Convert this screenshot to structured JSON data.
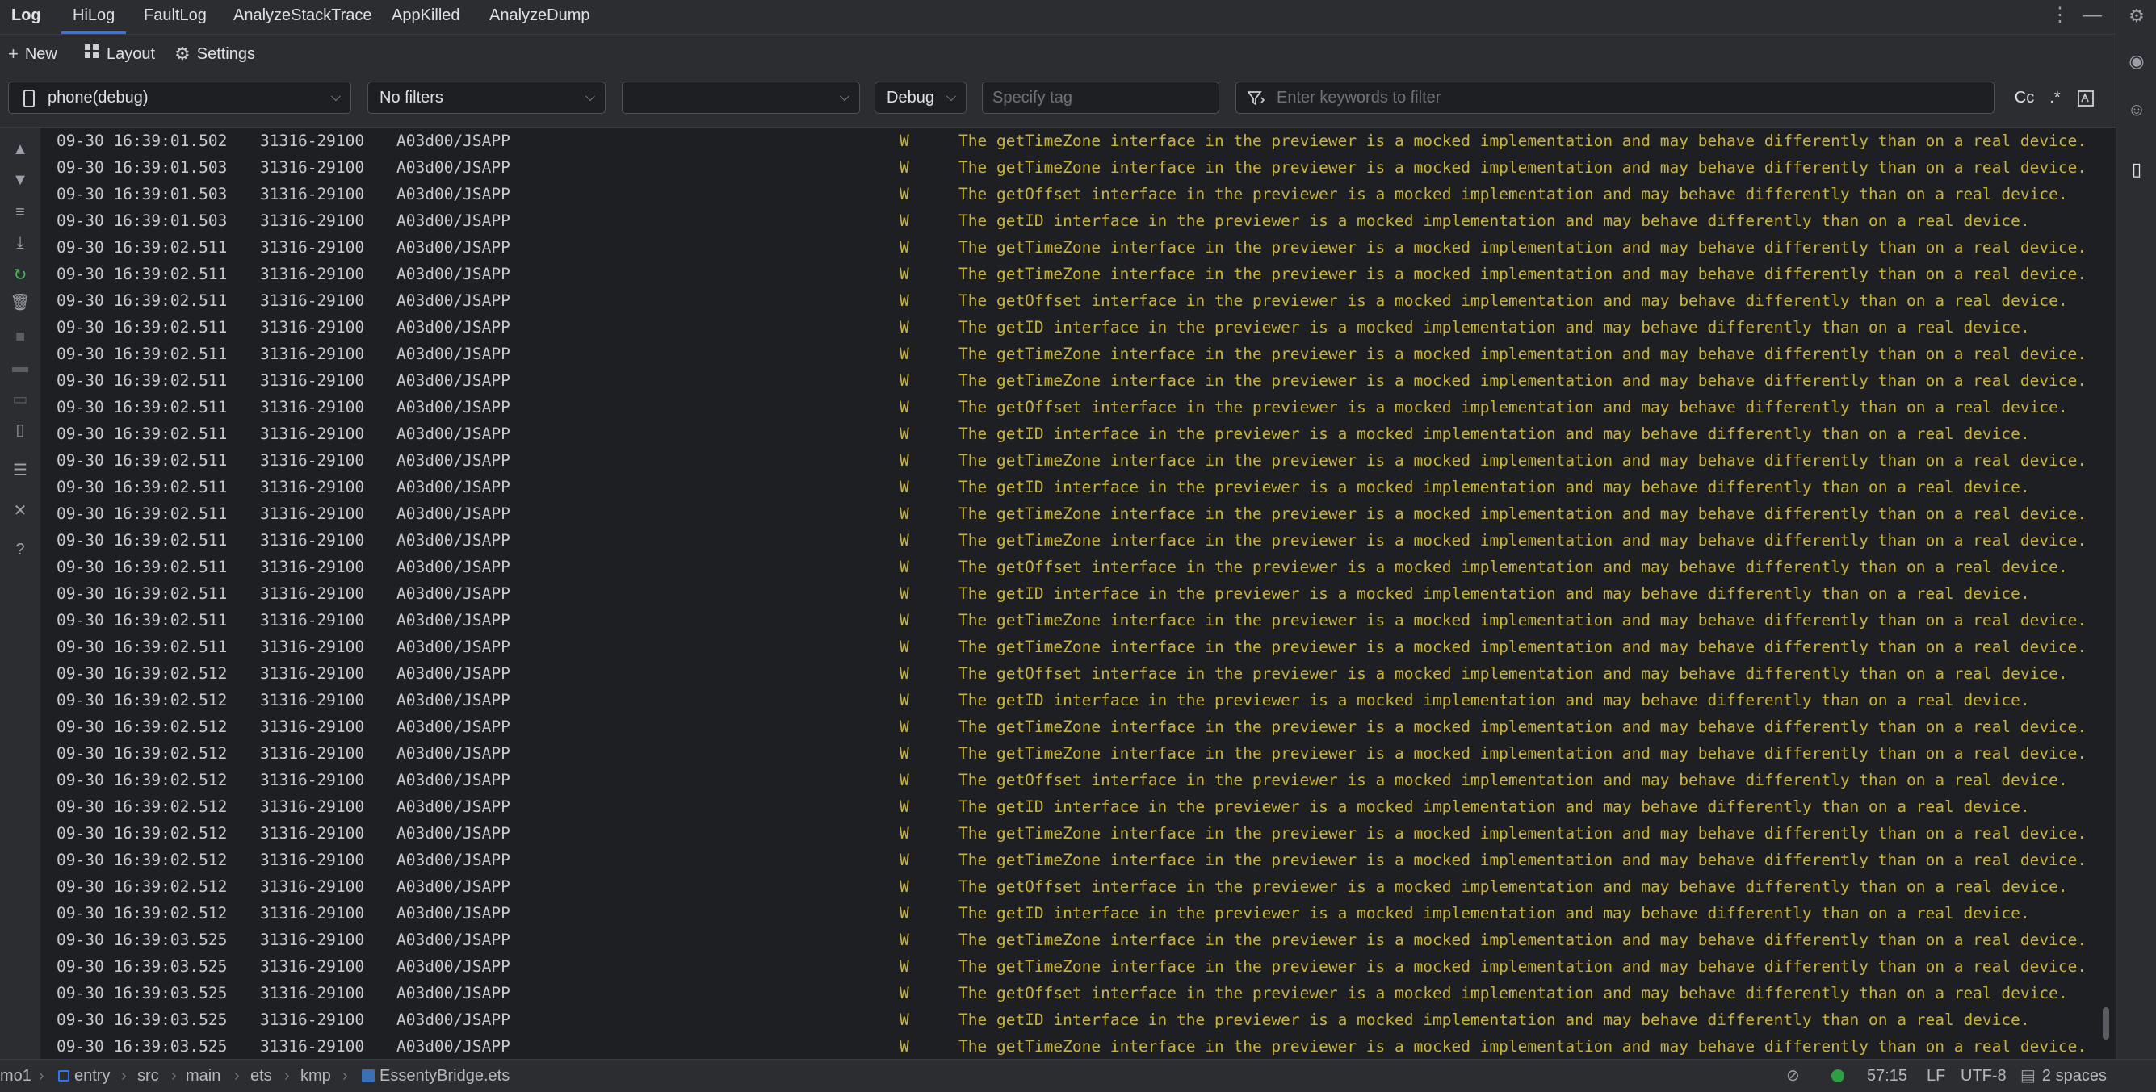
{
  "tabbar": {
    "title": "Log",
    "tabs": [
      {
        "label": "HiLog",
        "active": true
      },
      {
        "label": "FaultLog"
      },
      {
        "label": "AnalyzeStackTrace"
      },
      {
        "label": "AppKilled"
      },
      {
        "label": "AnalyzeDump"
      }
    ]
  },
  "toolbar": {
    "new_label": "New",
    "layout_label": "Layout",
    "settings_label": "Settings"
  },
  "filters": {
    "device": "phone(debug)",
    "filter_preset": "No filters",
    "process": "",
    "level": "Debug",
    "tag_placeholder": "Specify tag",
    "keyword_placeholder": "Enter keywords to filter",
    "case_label": "Cc",
    "regex_label": ".*"
  },
  "log": {
    "rows": [
      {
        "time": "09-30 16:39:01.502",
        "pid": "31316-29100",
        "tag": "A03d00/JSAPP",
        "level": "W",
        "msg": "The getTimeZone interface in the previewer is a mocked implementation and may behave differently than on a real device."
      },
      {
        "time": "09-30 16:39:01.503",
        "pid": "31316-29100",
        "tag": "A03d00/JSAPP",
        "level": "W",
        "msg": "The getTimeZone interface in the previewer is a mocked implementation and may behave differently than on a real device."
      },
      {
        "time": "09-30 16:39:01.503",
        "pid": "31316-29100",
        "tag": "A03d00/JSAPP",
        "level": "W",
        "msg": "The getOffset interface in the previewer is a mocked implementation and may behave differently than on a real device."
      },
      {
        "time": "09-30 16:39:01.503",
        "pid": "31316-29100",
        "tag": "A03d00/JSAPP",
        "level": "W",
        "msg": "The getID interface in the previewer is a mocked implementation and may behave differently than on a real device."
      },
      {
        "time": "09-30 16:39:02.511",
        "pid": "31316-29100",
        "tag": "A03d00/JSAPP",
        "level": "W",
        "msg": "The getTimeZone interface in the previewer is a mocked implementation and may behave differently than on a real device."
      },
      {
        "time": "09-30 16:39:02.511",
        "pid": "31316-29100",
        "tag": "A03d00/JSAPP",
        "level": "W",
        "msg": "The getTimeZone interface in the previewer is a mocked implementation and may behave differently than on a real device."
      },
      {
        "time": "09-30 16:39:02.511",
        "pid": "31316-29100",
        "tag": "A03d00/JSAPP",
        "level": "W",
        "msg": "The getOffset interface in the previewer is a mocked implementation and may behave differently than on a real device."
      },
      {
        "time": "09-30 16:39:02.511",
        "pid": "31316-29100",
        "tag": "A03d00/JSAPP",
        "level": "W",
        "msg": "The getID interface in the previewer is a mocked implementation and may behave differently than on a real device."
      },
      {
        "time": "09-30 16:39:02.511",
        "pid": "31316-29100",
        "tag": "A03d00/JSAPP",
        "level": "W",
        "msg": "The getTimeZone interface in the previewer is a mocked implementation and may behave differently than on a real device."
      },
      {
        "time": "09-30 16:39:02.511",
        "pid": "31316-29100",
        "tag": "A03d00/JSAPP",
        "level": "W",
        "msg": "The getTimeZone interface in the previewer is a mocked implementation and may behave differently than on a real device."
      },
      {
        "time": "09-30 16:39:02.511",
        "pid": "31316-29100",
        "tag": "A03d00/JSAPP",
        "level": "W",
        "msg": "The getOffset interface in the previewer is a mocked implementation and may behave differently than on a real device."
      },
      {
        "time": "09-30 16:39:02.511",
        "pid": "31316-29100",
        "tag": "A03d00/JSAPP",
        "level": "W",
        "msg": "The getID interface in the previewer is a mocked implementation and may behave differently than on a real device."
      },
      {
        "time": "09-30 16:39:02.511",
        "pid": "31316-29100",
        "tag": "A03d00/JSAPP",
        "level": "W",
        "msg": "The getTimeZone interface in the previewer is a mocked implementation and may behave differently than on a real device."
      },
      {
        "time": "09-30 16:39:02.511",
        "pid": "31316-29100",
        "tag": "A03d00/JSAPP",
        "level": "W",
        "msg": "The getID interface in the previewer is a mocked implementation and may behave differently than on a real device."
      },
      {
        "time": "09-30 16:39:02.511",
        "pid": "31316-29100",
        "tag": "A03d00/JSAPP",
        "level": "W",
        "msg": "The getTimeZone interface in the previewer is a mocked implementation and may behave differently than on a real device."
      },
      {
        "time": "09-30 16:39:02.511",
        "pid": "31316-29100",
        "tag": "A03d00/JSAPP",
        "level": "W",
        "msg": "The getTimeZone interface in the previewer is a mocked implementation and may behave differently than on a real device."
      },
      {
        "time": "09-30 16:39:02.511",
        "pid": "31316-29100",
        "tag": "A03d00/JSAPP",
        "level": "W",
        "msg": "The getOffset interface in the previewer is a mocked implementation and may behave differently than on a real device."
      },
      {
        "time": "09-30 16:39:02.511",
        "pid": "31316-29100",
        "tag": "A03d00/JSAPP",
        "level": "W",
        "msg": "The getID interface in the previewer is a mocked implementation and may behave differently than on a real device."
      },
      {
        "time": "09-30 16:39:02.511",
        "pid": "31316-29100",
        "tag": "A03d00/JSAPP",
        "level": "W",
        "msg": "The getTimeZone interface in the previewer is a mocked implementation and may behave differently than on a real device."
      },
      {
        "time": "09-30 16:39:02.511",
        "pid": "31316-29100",
        "tag": "A03d00/JSAPP",
        "level": "W",
        "msg": "The getTimeZone interface in the previewer is a mocked implementation and may behave differently than on a real device."
      },
      {
        "time": "09-30 16:39:02.512",
        "pid": "31316-29100",
        "tag": "A03d00/JSAPP",
        "level": "W",
        "msg": "The getOffset interface in the previewer is a mocked implementation and may behave differently than on a real device."
      },
      {
        "time": "09-30 16:39:02.512",
        "pid": "31316-29100",
        "tag": "A03d00/JSAPP",
        "level": "W",
        "msg": "The getID interface in the previewer is a mocked implementation and may behave differently than on a real device."
      },
      {
        "time": "09-30 16:39:02.512",
        "pid": "31316-29100",
        "tag": "A03d00/JSAPP",
        "level": "W",
        "msg": "The getTimeZone interface in the previewer is a mocked implementation and may behave differently than on a real device."
      },
      {
        "time": "09-30 16:39:02.512",
        "pid": "31316-29100",
        "tag": "A03d00/JSAPP",
        "level": "W",
        "msg": "The getTimeZone interface in the previewer is a mocked implementation and may behave differently than on a real device."
      },
      {
        "time": "09-30 16:39:02.512",
        "pid": "31316-29100",
        "tag": "A03d00/JSAPP",
        "level": "W",
        "msg": "The getOffset interface in the previewer is a mocked implementation and may behave differently than on a real device."
      },
      {
        "time": "09-30 16:39:02.512",
        "pid": "31316-29100",
        "tag": "A03d00/JSAPP",
        "level": "W",
        "msg": "The getID interface in the previewer is a mocked implementation and may behave differently than on a real device."
      },
      {
        "time": "09-30 16:39:02.512",
        "pid": "31316-29100",
        "tag": "A03d00/JSAPP",
        "level": "W",
        "msg": "The getTimeZone interface in the previewer is a mocked implementation and may behave differently than on a real device."
      },
      {
        "time": "09-30 16:39:02.512",
        "pid": "31316-29100",
        "tag": "A03d00/JSAPP",
        "level": "W",
        "msg": "The getTimeZone interface in the previewer is a mocked implementation and may behave differently than on a real device."
      },
      {
        "time": "09-30 16:39:02.512",
        "pid": "31316-29100",
        "tag": "A03d00/JSAPP",
        "level": "W",
        "msg": "The getOffset interface in the previewer is a mocked implementation and may behave differently than on a real device."
      },
      {
        "time": "09-30 16:39:02.512",
        "pid": "31316-29100",
        "tag": "A03d00/JSAPP",
        "level": "W",
        "msg": "The getID interface in the previewer is a mocked implementation and may behave differently than on a real device."
      },
      {
        "time": "09-30 16:39:03.525",
        "pid": "31316-29100",
        "tag": "A03d00/JSAPP",
        "level": "W",
        "msg": "The getTimeZone interface in the previewer is a mocked implementation and may behave differently than on a real device."
      },
      {
        "time": "09-30 16:39:03.525",
        "pid": "31316-29100",
        "tag": "A03d00/JSAPP",
        "level": "W",
        "msg": "The getTimeZone interface in the previewer is a mocked implementation and may behave differently than on a real device."
      },
      {
        "time": "09-30 16:39:03.525",
        "pid": "31316-29100",
        "tag": "A03d00/JSAPP",
        "level": "W",
        "msg": "The getOffset interface in the previewer is a mocked implementation and may behave differently than on a real device."
      },
      {
        "time": "09-30 16:39:03.525",
        "pid": "31316-29100",
        "tag": "A03d00/JSAPP",
        "level": "W",
        "msg": "The getID interface in the previewer is a mocked implementation and may behave differently than on a real device."
      },
      {
        "time": "09-30 16:39:03.525",
        "pid": "31316-29100",
        "tag": "A03d00/JSAPP",
        "level": "W",
        "msg": "The getTimeZone interface in the previewer is a mocked implementation and may behave differently than on a real device."
      }
    ]
  },
  "statusbar": {
    "breadcrumbs": [
      "mo1",
      "entry",
      "src",
      "main",
      "ets",
      "kmp",
      "EssentyBridge.ets"
    ],
    "position": "57:15",
    "line_ending": "LF",
    "encoding": "UTF-8",
    "indent": "2 spaces"
  },
  "colors": {
    "accent": "#3574f0",
    "warn_text": "#c9b43a",
    "status_ok": "#2ea043"
  }
}
